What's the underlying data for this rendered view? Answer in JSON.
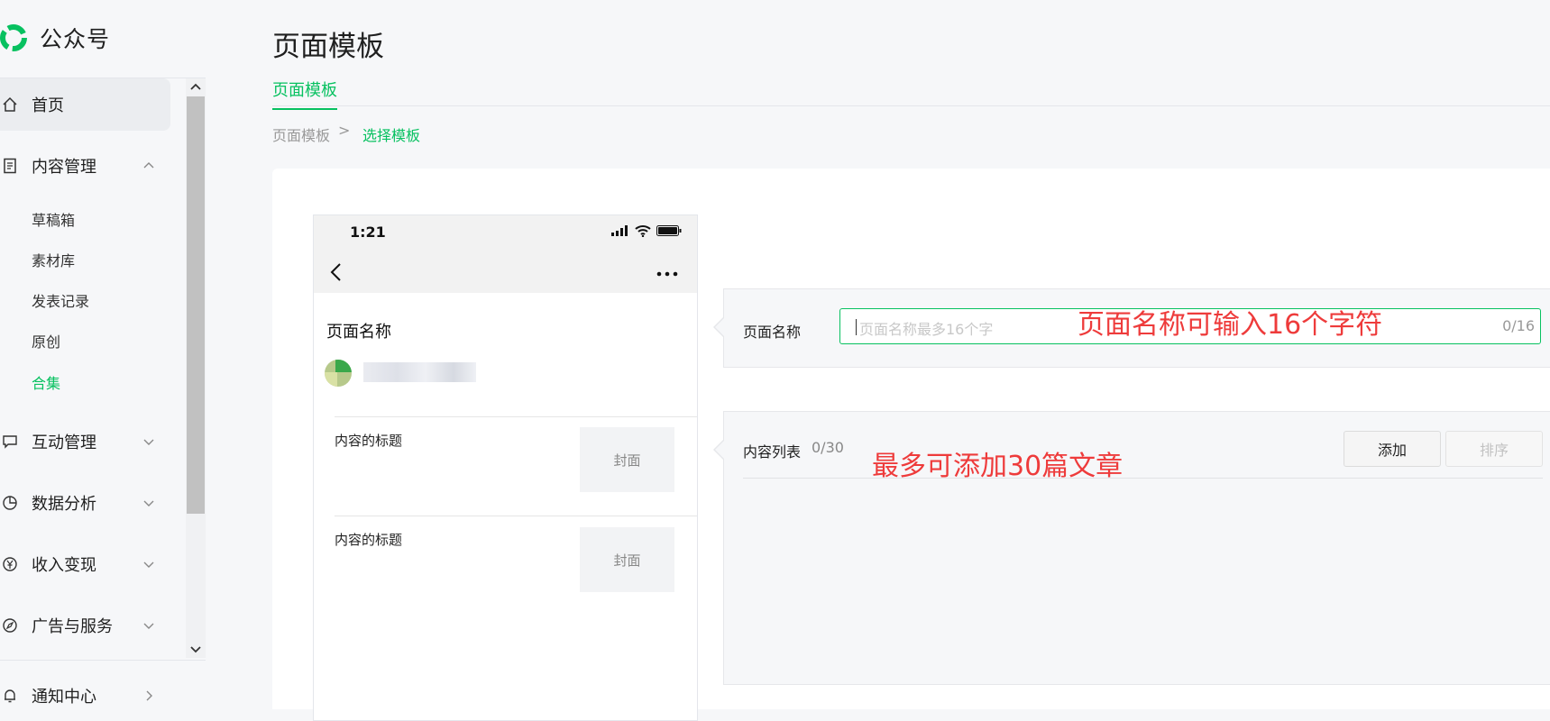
{
  "app": {
    "name": "公众号",
    "brand_color": "#07c160"
  },
  "sidebar": {
    "home": "首页",
    "content_mgmt": "内容管理",
    "sub_items": [
      "草稿箱",
      "素材库",
      "发表记录",
      "原创",
      "合集"
    ],
    "active_sub": "合集",
    "interaction": "互动管理",
    "data_analysis": "数据分析",
    "revenue": "收入变现",
    "ads_services": "广告与服务",
    "notifications": "通知中心"
  },
  "header": {
    "title": "页面模板",
    "tab": "页面模板",
    "breadcrumb": [
      "页面模板",
      "选择模板"
    ]
  },
  "phone": {
    "time": "1:21",
    "page_name": "页面名称",
    "items": [
      {
        "title": "内容的标题",
        "cover": "封面"
      },
      {
        "title": "内容的标题",
        "cover": "封面"
      }
    ]
  },
  "form": {
    "name_label": "页面名称",
    "name_placeholder": "页面名称最多16个字",
    "name_count": "0/16",
    "name_annotation": "页面名称可输入16个字符",
    "list_label": "内容列表",
    "list_count": "0/30",
    "list_annotation": "最多可添加30篇文章",
    "add_button": "添加",
    "sort_button": "排序",
    "annotation_color": "#ee3b3b"
  }
}
